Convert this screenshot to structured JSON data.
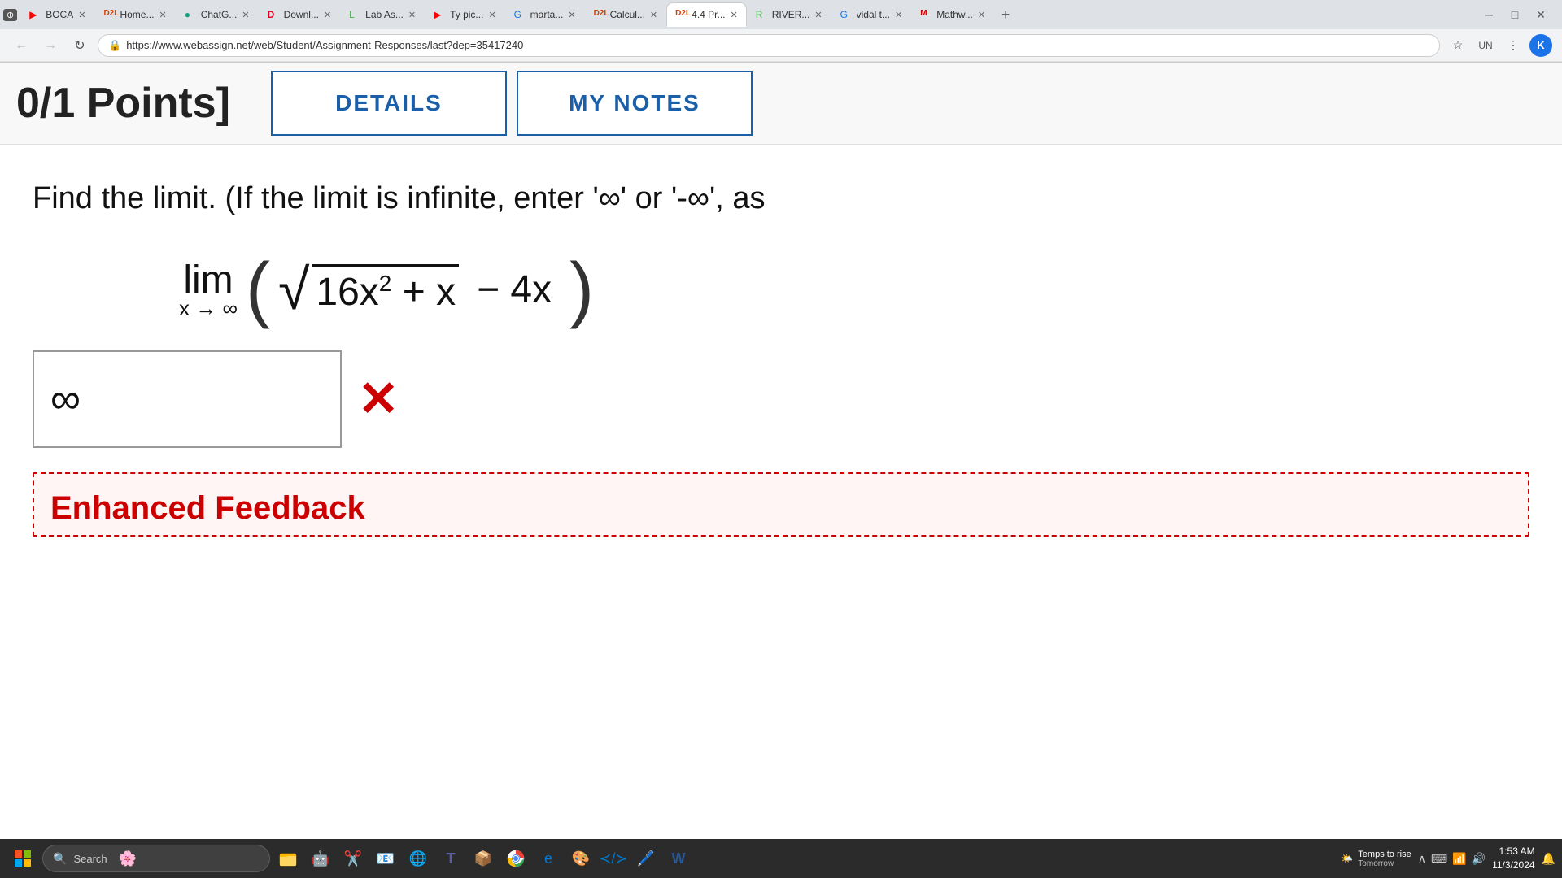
{
  "browser": {
    "url": "https://www.webassign.net/web/Student/Assignment-Responses/last?dep=35417240",
    "tabs": [
      {
        "id": "tab-yt",
        "label": "BOCA",
        "favicon": "▶",
        "favicon_class": "fav-youtube",
        "active": false
      },
      {
        "id": "tab-home",
        "label": "Home...",
        "favicon": "D",
        "favicon_class": "fav-d2l",
        "active": false
      },
      {
        "id": "tab-chat",
        "label": "ChatG...",
        "favicon": "C",
        "favicon_class": "fav-chatgpt",
        "active": false
      },
      {
        "id": "tab-downl",
        "label": "Downl...",
        "favicon": "D",
        "favicon_class": "fav-pinterest",
        "active": false
      },
      {
        "id": "tab-lab",
        "label": "Lab As...",
        "favicon": "L",
        "favicon_class": "fav-green",
        "active": false
      },
      {
        "id": "tab-ty",
        "label": "Ty pic...",
        "favicon": "▶",
        "favicon_class": "fav-youtube",
        "active": false
      },
      {
        "id": "tab-marta",
        "label": "marta...",
        "favicon": "G",
        "favicon_class": "fav-blue",
        "active": false
      },
      {
        "id": "tab-calcul",
        "label": "Calcul...",
        "favicon": "D",
        "favicon_class": "fav-d2l",
        "active": false
      },
      {
        "id": "tab-44pr",
        "label": "4.4 Pr...",
        "favicon": "D",
        "favicon_class": "fav-d2l",
        "active": true
      },
      {
        "id": "tab-river",
        "label": "RIVER...",
        "favicon": "R",
        "favicon_class": "fav-green",
        "active": false
      },
      {
        "id": "tab-vidal",
        "label": "vidal t...",
        "favicon": "G",
        "favicon_class": "fav-blue",
        "active": false
      },
      {
        "id": "tab-math",
        "label": "Mathw...",
        "favicon": "M",
        "favicon_class": "fav-red",
        "active": false
      }
    ],
    "profile_initial": "K"
  },
  "page": {
    "points_label": "0/1 Points]",
    "details_btn": "DETAILS",
    "my_notes_btn": "MY NOTES",
    "problem_text": "Find the limit. (If the limit is infinite, enter '∞' or '-∞', as",
    "limit_notation": "lim",
    "limit_subscript": "x → ∞",
    "formula_display": "( √(16x² + x) − 4x )",
    "answer_value": "∞",
    "wrong_mark": "✕",
    "feedback_title": "Enhanced Feedback"
  },
  "taskbar": {
    "search_placeholder": "Search",
    "time": "1:53 AM",
    "date": "11/3/2024",
    "weather_text": "Temps to rise",
    "weather_sub": "Tomorrow"
  }
}
